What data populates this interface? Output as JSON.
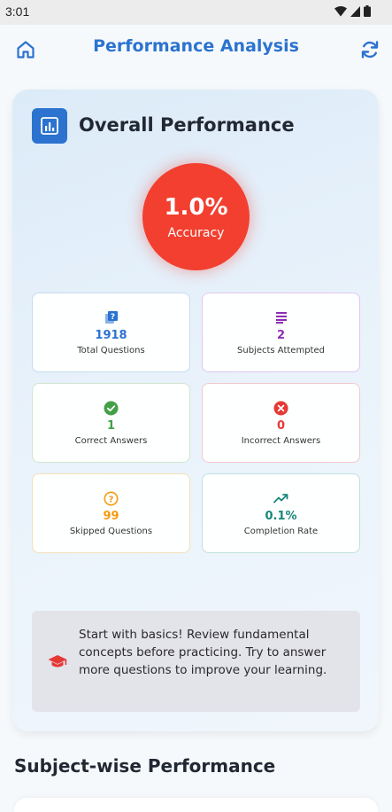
{
  "status_bar": {
    "time": "3:01",
    "icons": [
      "wifi-icon",
      "signal-icon",
      "battery-icon"
    ]
  },
  "header": {
    "title": "Performance Analysis",
    "left_icon": "home-icon",
    "right_icon": "refresh-icon"
  },
  "overall": {
    "title": "Overall Performance",
    "icon": "bar-chart-icon",
    "accuracy": {
      "value": "1.0%",
      "label": "Accuracy",
      "color": "#f23f2f"
    }
  },
  "stats": [
    {
      "value": "1918",
      "label": "Total Questions",
      "icon": "quiz-icon",
      "color": "#2b73cf"
    },
    {
      "value": "2",
      "label": "Subjects Attempted",
      "icon": "subject-list-icon",
      "color": "#8e2db3"
    },
    {
      "value": "1",
      "label": "Correct Answers",
      "icon": "check-circle-icon",
      "color": "#43a047"
    },
    {
      "value": "0",
      "label": "Incorrect Answers",
      "icon": "cancel-circle-icon",
      "color": "#e53935"
    },
    {
      "value": "99",
      "label": "Skipped Questions",
      "icon": "help-circle-icon",
      "color": "#f59a12"
    },
    {
      "value": "0.1%",
      "label": "Completion Rate",
      "icon": "trending-up-icon",
      "color": "#16877a"
    }
  ],
  "tip": {
    "text": "Start with basics! Review fundamental concepts before practicing. Try to answer more questions to improve your learning.",
    "icon": "graduation-cap-icon",
    "icon_color": "#e53935"
  },
  "subject_section": {
    "title": "Subject-wise Performance"
  }
}
